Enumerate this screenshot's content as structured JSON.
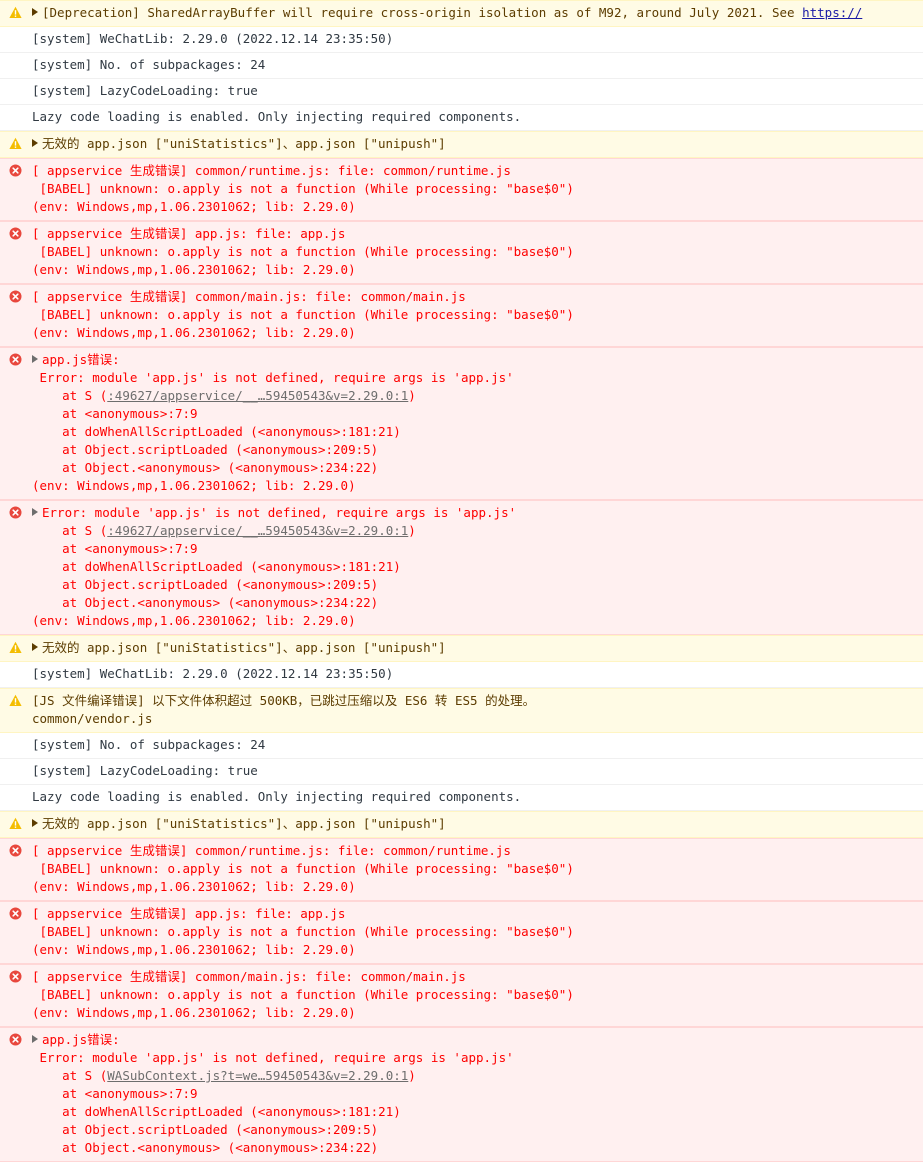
{
  "messages": [
    {
      "type": "warn",
      "expandable": true,
      "lines": [
        {
          "text": "[Deprecation] SharedArrayBuffer will require cross-origin isolation as of M92, around July 2021. See ",
          "link": "https://"
        }
      ]
    },
    {
      "type": "info",
      "lines": [
        {
          "text": "[system] WeChatLib: 2.29.0 (2022.12.14 23:35:50)"
        }
      ]
    },
    {
      "type": "info",
      "lines": [
        {
          "text": "[system] No. of subpackages: 24"
        }
      ]
    },
    {
      "type": "info",
      "lines": [
        {
          "text": "[system] LazyCodeLoading: true"
        }
      ]
    },
    {
      "type": "info",
      "lines": [
        {
          "text": "Lazy code loading is enabled. Only injecting required components."
        }
      ]
    },
    {
      "type": "warn",
      "expandable": true,
      "lines": [
        {
          "text": "无效的 app.json [\"uniStatistics\"]、app.json [\"unipush\"]"
        }
      ]
    },
    {
      "type": "error",
      "lines": [
        {
          "text": "[ appservice 生成错误] common/runtime.js: file: common/runtime.js"
        },
        {
          "text": " [BABEL] unknown: o.apply is not a function (While processing: \"base$0\")"
        },
        {
          "text": "(env: Windows,mp,1.06.2301062; lib: 2.29.0)"
        }
      ]
    },
    {
      "type": "error",
      "lines": [
        {
          "text": "[ appservice 生成错误] app.js: file: app.js"
        },
        {
          "text": " [BABEL] unknown: o.apply is not a function (While processing: \"base$0\")"
        },
        {
          "text": "(env: Windows,mp,1.06.2301062; lib: 2.29.0)"
        }
      ]
    },
    {
      "type": "error",
      "lines": [
        {
          "text": "[ appservice 生成错误] common/main.js: file: common/main.js"
        },
        {
          "text": " [BABEL] unknown: o.apply is not a function (While processing: \"base$0\")"
        },
        {
          "text": "(env: Windows,mp,1.06.2301062; lib: 2.29.0)"
        }
      ]
    },
    {
      "type": "error",
      "expandable": true,
      "lines": [
        {
          "text": "app.js错误:"
        },
        {
          "text": " Error: module 'app.js' is not defined, require args is 'app.js'"
        },
        {
          "text": "    at S (",
          "link": ":49627/appservice/__…59450543&v=2.29.0:1",
          "after": ")"
        },
        {
          "text": "    at <anonymous>:7:9"
        },
        {
          "text": "    at doWhenAllScriptLoaded (<anonymous>:181:21)"
        },
        {
          "text": "    at Object.scriptLoaded (<anonymous>:209:5)"
        },
        {
          "text": "    at Object.<anonymous> (<anonymous>:234:22)"
        },
        {
          "text": "(env: Windows,mp,1.06.2301062; lib: 2.29.0)"
        }
      ]
    },
    {
      "type": "error",
      "expandable": true,
      "lines": [
        {
          "text": "Error: module 'app.js' is not defined, require args is 'app.js'"
        },
        {
          "text": "    at S (",
          "link": ":49627/appservice/__…59450543&v=2.29.0:1",
          "after": ")"
        },
        {
          "text": "    at <anonymous>:7:9"
        },
        {
          "text": "    at doWhenAllScriptLoaded (<anonymous>:181:21)"
        },
        {
          "text": "    at Object.scriptLoaded (<anonymous>:209:5)"
        },
        {
          "text": "    at Object.<anonymous> (<anonymous>:234:22)"
        },
        {
          "text": "(env: Windows,mp,1.06.2301062; lib: 2.29.0)"
        }
      ]
    },
    {
      "type": "warn",
      "expandable": true,
      "lines": [
        {
          "text": "无效的 app.json [\"uniStatistics\"]、app.json [\"unipush\"]"
        }
      ]
    },
    {
      "type": "info",
      "lines": [
        {
          "text": "[system] WeChatLib: 2.29.0 (2022.12.14 23:35:50)"
        }
      ]
    },
    {
      "type": "warn",
      "lines": [
        {
          "text": "[JS 文件编译错误] 以下文件体积超过 500KB，已跳过压缩以及 ES6 转 ES5 的处理。"
        },
        {
          "text": "common/vendor.js"
        }
      ]
    },
    {
      "type": "info",
      "lines": [
        {
          "text": "[system] No. of subpackages: 24"
        }
      ]
    },
    {
      "type": "info",
      "lines": [
        {
          "text": "[system] LazyCodeLoading: true"
        }
      ]
    },
    {
      "type": "info",
      "lines": [
        {
          "text": "Lazy code loading is enabled. Only injecting required components."
        }
      ]
    },
    {
      "type": "warn",
      "expandable": true,
      "lines": [
        {
          "text": "无效的 app.json [\"uniStatistics\"]、app.json [\"unipush\"]"
        }
      ]
    },
    {
      "type": "error",
      "lines": [
        {
          "text": "[ appservice 生成错误] common/runtime.js: file: common/runtime.js"
        },
        {
          "text": " [BABEL] unknown: o.apply is not a function (While processing: \"base$0\")"
        },
        {
          "text": "(env: Windows,mp,1.06.2301062; lib: 2.29.0)"
        }
      ]
    },
    {
      "type": "error",
      "lines": [
        {
          "text": "[ appservice 生成错误] app.js: file: app.js"
        },
        {
          "text": " [BABEL] unknown: o.apply is not a function (While processing: \"base$0\")"
        },
        {
          "text": "(env: Windows,mp,1.06.2301062; lib: 2.29.0)"
        }
      ]
    },
    {
      "type": "error",
      "lines": [
        {
          "text": "[ appservice 生成错误] common/main.js: file: common/main.js"
        },
        {
          "text": " [BABEL] unknown: o.apply is not a function (While processing: \"base$0\")"
        },
        {
          "text": "(env: Windows,mp,1.06.2301062; lib: 2.29.0)"
        }
      ]
    },
    {
      "type": "error",
      "expandable": true,
      "lines": [
        {
          "text": "app.js错误:"
        },
        {
          "text": " Error: module 'app.js' is not defined, require args is 'app.js'"
        },
        {
          "text": "    at S (",
          "link": "WASubContext.js?t=we…59450543&v=2.29.0:1",
          "after": ")"
        },
        {
          "text": "    at <anonymous>:7:9"
        },
        {
          "text": "    at doWhenAllScriptLoaded (<anonymous>:181:21)"
        },
        {
          "text": "    at Object.scriptLoaded (<anonymous>:209:5)"
        },
        {
          "text": "    at Object.<anonymous> (<anonymous>:234:22)"
        }
      ]
    }
  ]
}
